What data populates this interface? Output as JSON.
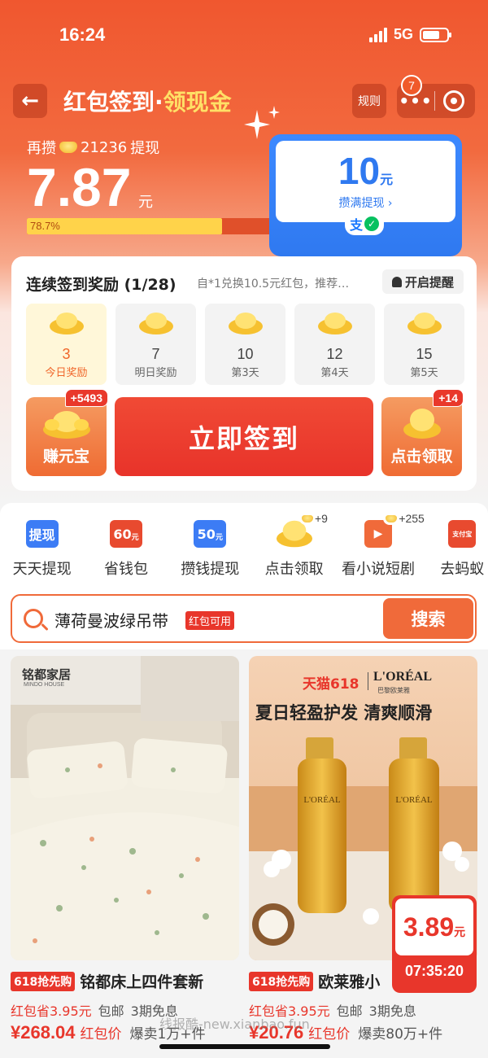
{
  "status_bar": {
    "time": "16:24",
    "network": "5G"
  },
  "header": {
    "back_icon": "arrow-left-icon",
    "title_main": "红包签到·",
    "title_highlight": "领现金",
    "rules_label": "规则",
    "more_badge": "7"
  },
  "balance": {
    "prefix": "再攒",
    "coins": "21236",
    "suffix": "提现",
    "amount": "7.87",
    "unit": "元",
    "progress_label": "78.7%",
    "progress_fraction": 0.787
  },
  "goal": {
    "amount": "10",
    "unit": "元",
    "label": "攒满提现 ›",
    "alipay_glyph": "支",
    "wechat_glyph": "✓"
  },
  "checkin": {
    "title": "连续签到奖励 (1/28)",
    "note": "自*1兑换10.5元红包，推荐您…",
    "remind_label": "开启提醒",
    "days": [
      {
        "value": "3",
        "label": "今日奖励"
      },
      {
        "value": "7",
        "label": "明日奖励"
      },
      {
        "value": "10",
        "label": "第3天"
      },
      {
        "value": "12",
        "label": "第4天"
      },
      {
        "value": "15",
        "label": "第5天"
      }
    ],
    "earn_label": "赚元宝",
    "earn_badge": "+5493",
    "checkin_button": "立即签到",
    "claim_label": "点击领取",
    "claim_badge": "+14"
  },
  "shortcuts": [
    {
      "label": "天天提现",
      "icon_text": "提现",
      "icon_color": "#3c7cf5"
    },
    {
      "label": "省钱包",
      "icon_text": "60",
      "icon_unit": "元",
      "icon_color": "#e84a2f"
    },
    {
      "label": "攒钱提现",
      "icon_text": "50",
      "icon_unit": "元",
      "icon_color": "#3c7cf5"
    },
    {
      "label": "点击领取",
      "badge": "+9"
    },
    {
      "label": "看小说短剧",
      "badge": "+255"
    },
    {
      "label": "去蚂蚁",
      "icon_text": "支付宝"
    }
  ],
  "search": {
    "query": "薄荷曼波绿吊带",
    "tag": "红包可用",
    "button": "搜索"
  },
  "products": [
    {
      "brand": "铭都家居",
      "brand_sub": "MINDO HOUSE",
      "tag": "618抢先购",
      "name": "铭都床上四件套新",
      "save": "红包省3.95元",
      "shipping": "包邮",
      "installment": "3期免息",
      "price": "¥268.04",
      "price_label": "红包价",
      "sold": "爆卖1万+件"
    },
    {
      "banner_platform": "天猫618",
      "banner_brand": "L'ORÉAL",
      "banner_brand_sub": "巴黎欧莱雅",
      "headline": "夏日轻盈护发 清爽顺滑",
      "bottle_text": "L'ORÉAL",
      "tag": "618抢先购",
      "name": "欧莱雅小",
      "save": "红包省3.95元",
      "shipping": "包邮",
      "installment": "3期免息",
      "price": "¥20.76",
      "price_label": "红包价",
      "sold": "爆卖80万+件"
    }
  ],
  "floating_deal": {
    "price": "3.89",
    "unit": "元",
    "timer": "07:35:20"
  },
  "watermark": "线报酷-new.xianbao.fun",
  "colors": {
    "accent": "#f06a3a",
    "red": "#e8362b",
    "blue": "#2f79f0",
    "gold": "#ffd34a"
  }
}
